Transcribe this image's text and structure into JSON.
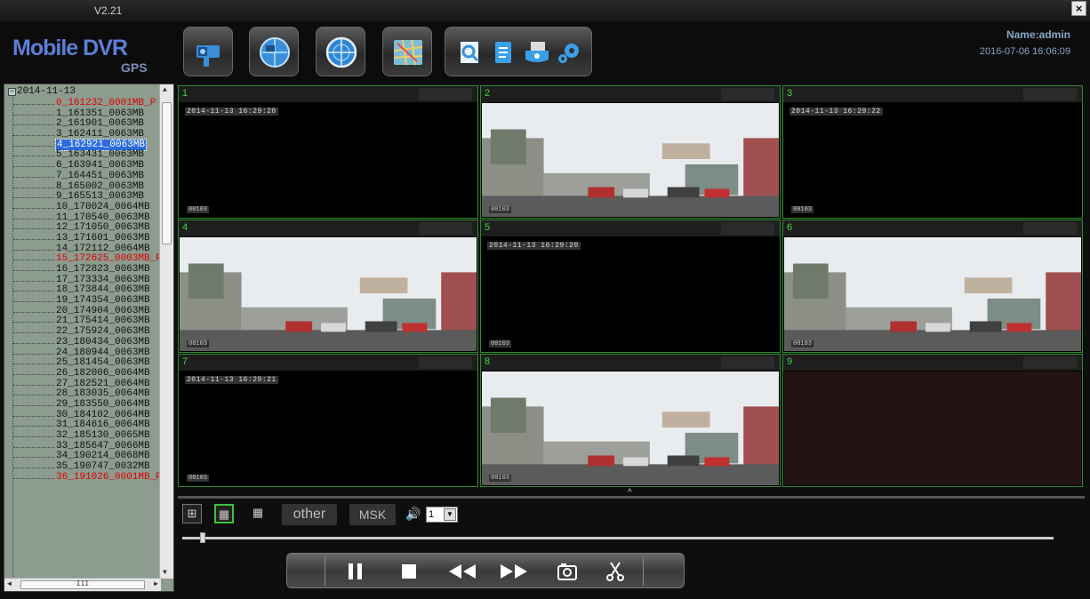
{
  "app": {
    "version": "V2.21",
    "logo_main": "Mobile DVR",
    "logo_sub": "GPS",
    "close_label": "×"
  },
  "user": {
    "name": "Name:admin",
    "datetime": "2016-07-06 16:06:09"
  },
  "toolbar": {
    "main_buttons": [
      "camera-icon",
      "globe-icon",
      "radar-icon",
      "map-icon"
    ],
    "group_buttons": [
      "search-icon",
      "document-icon",
      "database-icon",
      "gear-icon"
    ]
  },
  "tree": {
    "root": "2014-11-13",
    "items": [
      {
        "label": "0_161232_0001MB_P",
        "color": "#e00000"
      },
      {
        "label": "1_161351_0063MB"
      },
      {
        "label": "2_161901_0063MB"
      },
      {
        "label": "3_162411_0063MB"
      },
      {
        "label": "4_162921_0063MB",
        "selected": true
      },
      {
        "label": "5_163431_0063MB"
      },
      {
        "label": "6_163941_0063MB"
      },
      {
        "label": "7_164451_0063MB"
      },
      {
        "label": "8_165002_0063MB"
      },
      {
        "label": "9_165513_0063MB"
      },
      {
        "label": "10_170024_0064MB"
      },
      {
        "label": "11_170540_0063MB"
      },
      {
        "label": "12_171050_0063MB"
      },
      {
        "label": "13_171601_0063MB"
      },
      {
        "label": "14_172112_0064MB"
      },
      {
        "label": "15_172625_0003MB_P",
        "color": "#e00000"
      },
      {
        "label": "16_172823_0063MB"
      },
      {
        "label": "17_173334_0063MB"
      },
      {
        "label": "18_173844_0063MB"
      },
      {
        "label": "19_174354_0063MB"
      },
      {
        "label": "20_174904_0063MB"
      },
      {
        "label": "21_175414_0063MB"
      },
      {
        "label": "22_175924_0063MB"
      },
      {
        "label": "23_180434_0063MB"
      },
      {
        "label": "24_180944_0063MB"
      },
      {
        "label": "25_181454_0063MB"
      },
      {
        "label": "26_182006_0064MB"
      },
      {
        "label": "27_182521_0064MB"
      },
      {
        "label": "28_183035_0064MB"
      },
      {
        "label": "29_183550_0064MB"
      },
      {
        "label": "30_184102_0064MB"
      },
      {
        "label": "31_184616_0064MB"
      },
      {
        "label": "32_185130_0065MB"
      },
      {
        "label": "33_185647_0066MB"
      },
      {
        "label": "34_190214_0068MB"
      },
      {
        "label": "35_190747_0032MB"
      },
      {
        "label": "36_191026_0001MB_P",
        "color": "#e00000"
      }
    ],
    "hscroll_label": "III"
  },
  "channels": [
    {
      "num": "1",
      "type": "dark",
      "osd": "2014-11-13 16:29:20",
      "osd2": "00103"
    },
    {
      "num": "2",
      "type": "street",
      "osd2": "00103"
    },
    {
      "num": "3",
      "type": "dark",
      "osd": "2014-11-13 16:29:22",
      "osd2": "00103"
    },
    {
      "num": "4",
      "type": "street",
      "osd2": "00103"
    },
    {
      "num": "5",
      "type": "dark",
      "osd": "2014-11-13 16:29:20",
      "osd2": "00103"
    },
    {
      "num": "6",
      "type": "street",
      "osd2": "00103"
    },
    {
      "num": "7",
      "type": "dark",
      "osd": "2014-11-13 16:29:21",
      "osd2": "00103"
    },
    {
      "num": "8",
      "type": "street",
      "osd2": "00103"
    },
    {
      "num": "9",
      "type": "empty"
    }
  ],
  "controls": {
    "layout_buttons": [
      "grid-4-icon",
      "grid-9-icon",
      "grid-16-icon"
    ],
    "other_label": "other",
    "msk_label": "MSK",
    "volume_value": "1",
    "playback_fraction": 0.02
  },
  "player": {
    "buttons": [
      "pause-icon",
      "stop-icon",
      "rewind-icon",
      "fast-forward-icon",
      "snapshot-icon",
      "clip-icon"
    ]
  },
  "colors": {
    "accent_green": "#3ec03e",
    "warning_red": "#e00000",
    "selection_blue": "#2b6ce0"
  }
}
